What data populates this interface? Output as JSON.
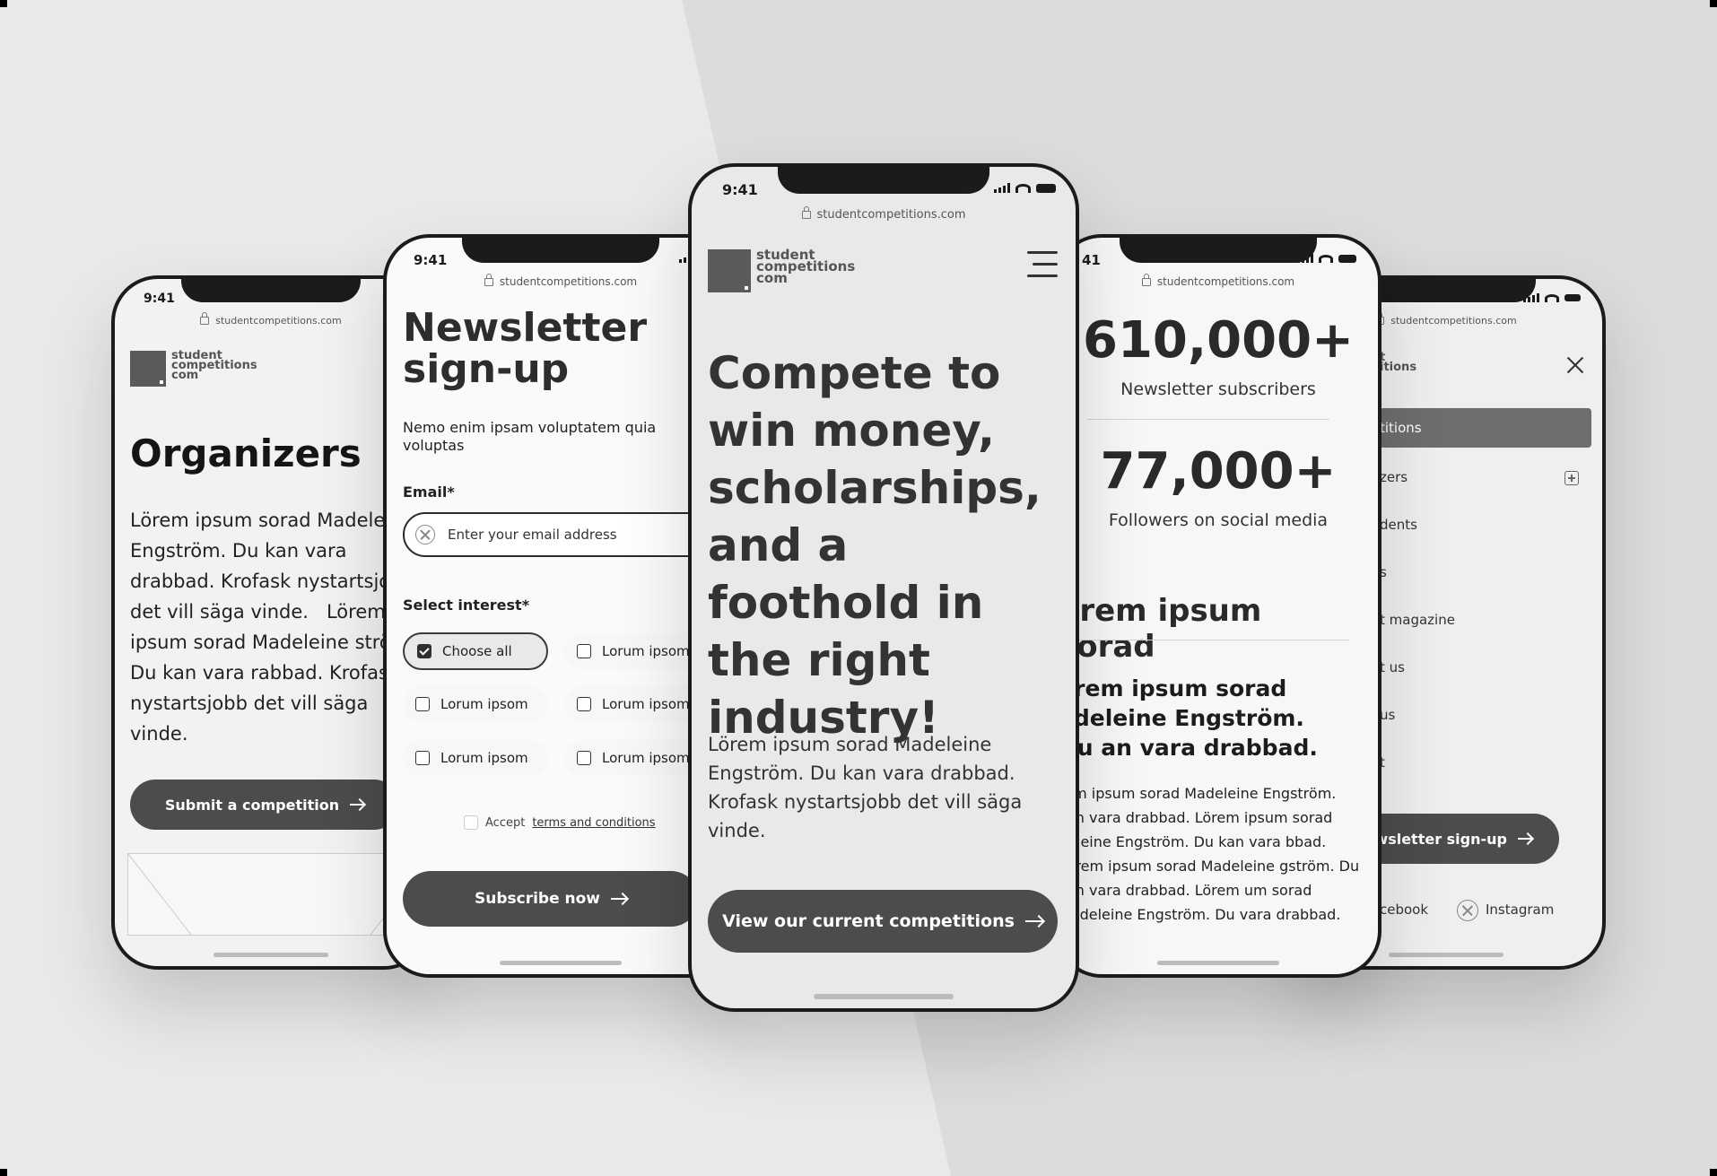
{
  "status": {
    "time": "9:41"
  },
  "url": "studentcompetitions.com",
  "logo": {
    "line1": "student",
    "line2": "competitions",
    "line3": "com"
  },
  "organizers": {
    "title": "Organizers",
    "body": "Lörem ipsum sorad Madeleine Engström. Du kan vara drabbad. Krofask nystartsjobb det vill säga vinde.   Lörem ipsum sorad Madeleine ström. Du kan vara rabbad. Krofask nystartsjobb det vill säga vinde.",
    "cta": "Submit a competition"
  },
  "newsletter": {
    "title": "Newsletter sign-up",
    "subtitle": "Nemo enim ipsam voluptatem quia voluptas",
    "email_label": "Email*",
    "email_placeholder": "Enter your email address",
    "interest_label": "Select interest*",
    "choose_all": "Choose all",
    "options": [
      "Lorum ipsom",
      "Lorum ipsom",
      "Lorum ipsom",
      "Lorum ipsom",
      "Lorum ipsom"
    ],
    "accept_prefix": "Accept",
    "accept_link": "terms and conditions",
    "cta": "Subscribe now"
  },
  "home": {
    "headline": "Compete to win money, scholarships, and a foothold in the right industry!",
    "body": "Lörem ipsum sorad Madeleine Engström. Du kan vara drabbad. Krofask nystartsjobb det vill säga vinde.",
    "cta": "View our current competitions"
  },
  "stats": {
    "time": "41",
    "stat1_value": "610,000+",
    "stat1_label": "Newsletter subscribers",
    "stat2_value": "77,000+",
    "stat2_label": "Followers on social media",
    "heading": "örem ipsum sorad",
    "subheading": "örem ipsum sorad adeleine Engström. Du an vara drabbad.",
    "body": "rem ipsum sorad Madeleine Engström. kan vara drabbad. Lörem ipsum sorad deleine Engström. Du kan vara bbad. Lörem ipsum sorad Madeleine gström. Du kan vara drabbad. Lörem um sorad Madeleine Engström. Du vara drabbad."
  },
  "menu": {
    "logo_partial": "t",
    "logo_partial2": "itions",
    "items": [
      "titions",
      "zers",
      "dents",
      "s",
      "t magazine",
      "t us",
      "us",
      "t"
    ],
    "cta": "wsletter sign-up",
    "social1": "cebook",
    "social2": "Instagram"
  }
}
